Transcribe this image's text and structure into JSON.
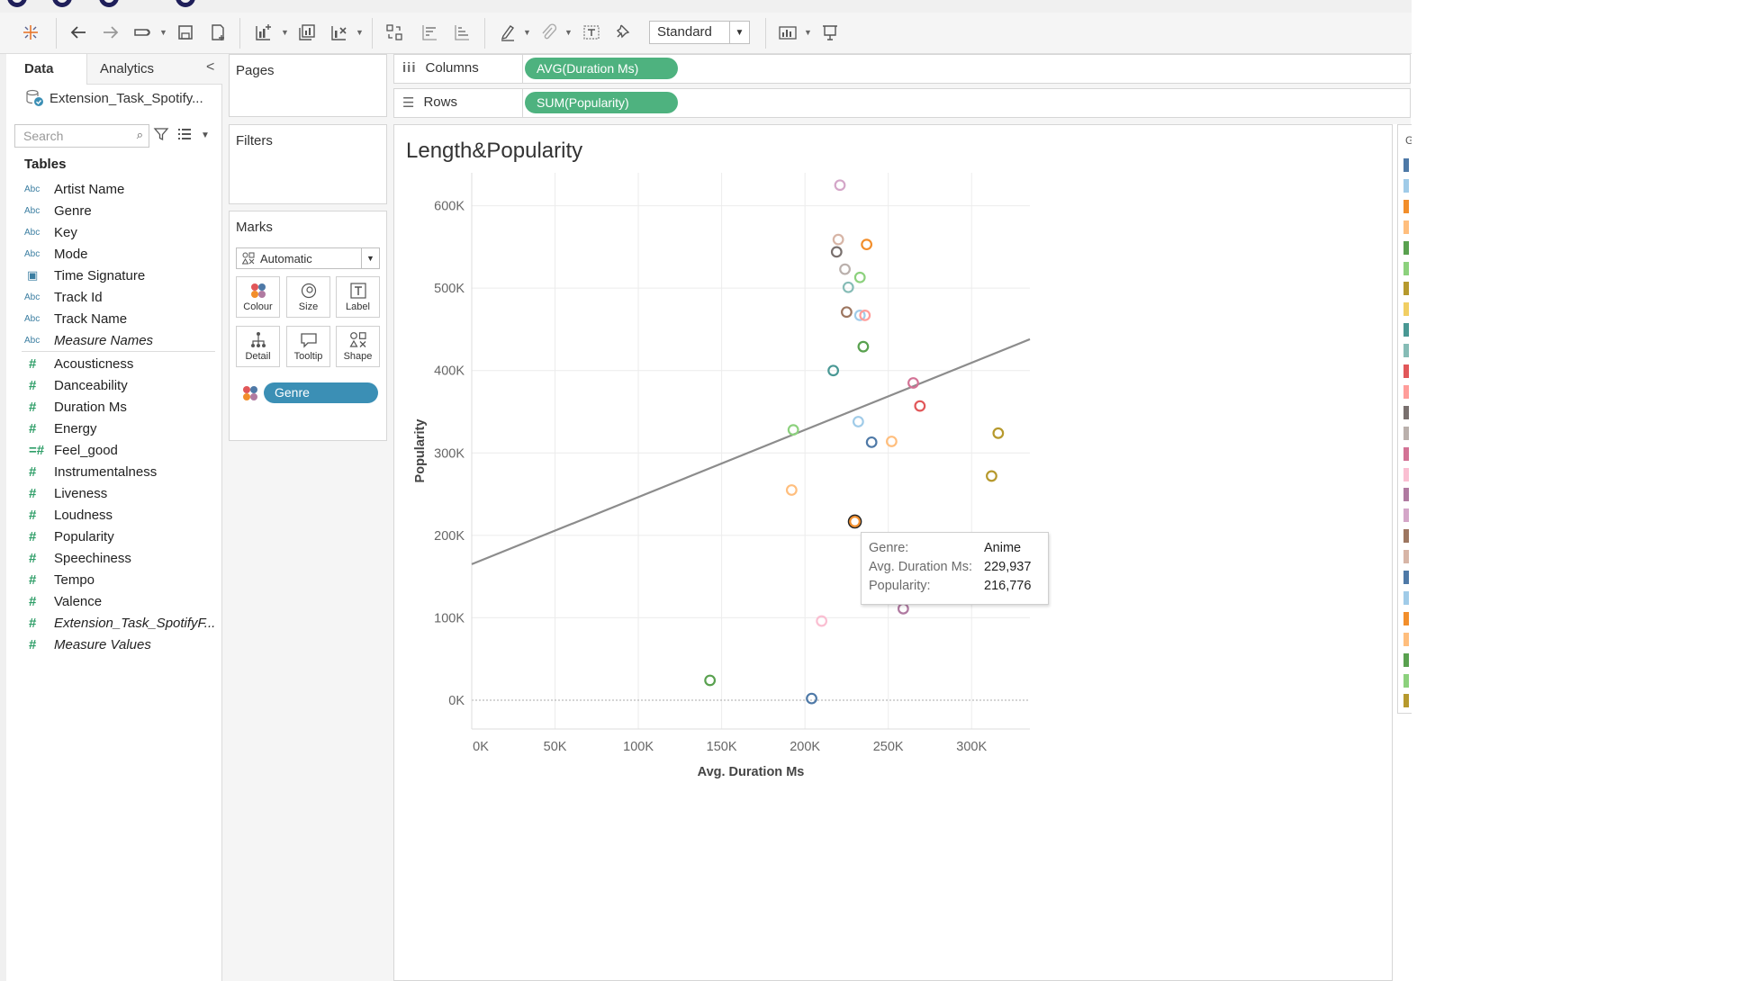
{
  "toolbar": {
    "view_size": "Standard"
  },
  "data_pane": {
    "tabs": [
      "Data",
      "Analytics"
    ],
    "datasource": "Extension_Task_Spotify...",
    "search_placeholder": "Search",
    "tables_heading": "Tables",
    "dimensions": [
      {
        "icon": "Abc",
        "name": "Artist Name"
      },
      {
        "icon": "Abc",
        "name": "Genre"
      },
      {
        "icon": "Abc",
        "name": "Key"
      },
      {
        "icon": "Abc",
        "name": "Mode"
      },
      {
        "icon": "calendar",
        "name": "Time Signature"
      },
      {
        "icon": "Abc",
        "name": "Track Id"
      },
      {
        "icon": "Abc",
        "name": "Track Name"
      },
      {
        "icon": "Abc",
        "name": "Measure Names"
      }
    ],
    "measures": [
      "Acousticness",
      "Danceability",
      "Duration Ms",
      "Energy",
      "Feel_good",
      "Instrumentalness",
      "Liveness",
      "Loudness",
      "Popularity",
      "Speechiness",
      "Tempo",
      "Valence",
      "Extension_Task_SpotifyF...",
      "Measure Values"
    ]
  },
  "cards": {
    "pages": "Pages",
    "filters": "Filters",
    "marks": "Marks",
    "mark_type": "Automatic",
    "mark_buttons": [
      "Colour",
      "Size",
      "Label",
      "Detail",
      "Tooltip",
      "Shape"
    ],
    "colour_pill": "Genre"
  },
  "shelves": {
    "columns_label": "Columns",
    "columns_pill": "AVG(Duration Ms)",
    "rows_label": "Rows",
    "rows_pill": "SUM(Popularity)"
  },
  "sheet": {
    "title": "Length&Popularity"
  },
  "tooltip": {
    "rows": [
      {
        "key": "Genre:",
        "value": "Anime"
      },
      {
        "key": "Avg. Duration Ms:",
        "value": "229,937"
      },
      {
        "key": "Popularity:",
        "value": "216,776"
      }
    ]
  },
  "legend_title_fragment": "G",
  "legend_colors": [
    "#4e79a7",
    "#a0cbe8",
    "#f28e2b",
    "#ffbe7d",
    "#59a14f",
    "#8cd17d",
    "#b6992d",
    "#f1ce63",
    "#499894",
    "#86bcb6",
    "#e15759",
    "#ff9d9a",
    "#79706e",
    "#bab0ac",
    "#d37295",
    "#fabfd2",
    "#b07aa1",
    "#d4a6c8",
    "#9d7660",
    "#d7b5a6",
    "#4e79a7",
    "#a0cbe8",
    "#f28e2b",
    "#ffbe7d",
    "#59a14f",
    "#8cd17d",
    "#b6992d"
  ],
  "chart_data": {
    "type": "scatter",
    "title": "Length&Popularity",
    "xlabel": "Avg. Duration Ms",
    "ylabel": "Popularity",
    "x_ticks": [
      "0K",
      "50K",
      "100K",
      "150K",
      "200K",
      "250K",
      "300K"
    ],
    "y_ticks": [
      "0K",
      "100K",
      "200K",
      "300K",
      "400K",
      "500K",
      "600K"
    ],
    "xlim": [
      0,
      335000
    ],
    "ylim": [
      -35000,
      640000
    ],
    "trend_line": {
      "x": [
        0,
        335000
      ],
      "y": [
        165000,
        438000
      ]
    },
    "points": [
      {
        "x": 221000,
        "y": 625000,
        "color": "#d4a6c8"
      },
      {
        "x": 220000,
        "y": 559000,
        "color": "#d7b5a6"
      },
      {
        "x": 237000,
        "y": 553000,
        "color": "#f28e2b"
      },
      {
        "x": 219000,
        "y": 544000,
        "color": "#79706e"
      },
      {
        "x": 224000,
        "y": 523000,
        "color": "#bab0ac"
      },
      {
        "x": 233000,
        "y": 513000,
        "color": "#8cd17d"
      },
      {
        "x": 226000,
        "y": 501000,
        "color": "#86bcb6"
      },
      {
        "x": 225000,
        "y": 471000,
        "color": "#9d7660"
      },
      {
        "x": 233000,
        "y": 467000,
        "color": "#a0cbe8"
      },
      {
        "x": 236000,
        "y": 467000,
        "color": "#ff9d9a"
      },
      {
        "x": 235000,
        "y": 429000,
        "color": "#59a14f"
      },
      {
        "x": 217000,
        "y": 400000,
        "color": "#499894"
      },
      {
        "x": 265000,
        "y": 385000,
        "color": "#d37295"
      },
      {
        "x": 269000,
        "y": 357000,
        "color": "#e15759"
      },
      {
        "x": 232000,
        "y": 338000,
        "color": "#a0cbe8"
      },
      {
        "x": 193000,
        "y": 328000,
        "color": "#8cd17d"
      },
      {
        "x": 316000,
        "y": 324000,
        "color": "#b6992d"
      },
      {
        "x": 240000,
        "y": 313000,
        "color": "#4e79a7"
      },
      {
        "x": 252000,
        "y": 314000,
        "color": "#ffbe7d"
      },
      {
        "x": 312000,
        "y": 272000,
        "color": "#b6992d"
      },
      {
        "x": 192000,
        "y": 255000,
        "color": "#ffbe7d"
      },
      {
        "x": 229937,
        "y": 216776,
        "color": "#f28e2b"
      },
      {
        "x": 259000,
        "y": 111000,
        "color": "#b07aa1"
      },
      {
        "x": 210000,
        "y": 96000,
        "color": "#fabfd2"
      },
      {
        "x": 143000,
        "y": 24000,
        "color": "#59a14f"
      },
      {
        "x": 204000,
        "y": 2000,
        "color": "#4e79a7"
      }
    ]
  }
}
